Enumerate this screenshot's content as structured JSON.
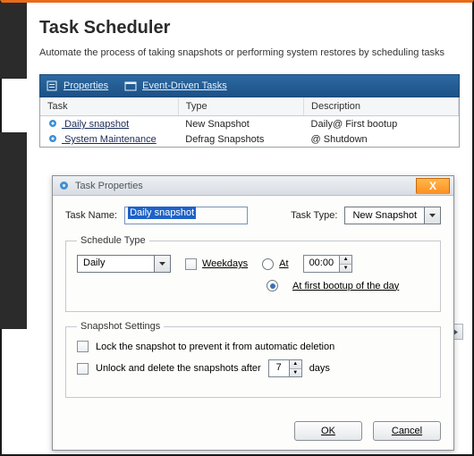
{
  "page": {
    "title": "Task Scheduler",
    "subtitle": "Automate the process of taking snapshots or performing system restores by scheduling tasks"
  },
  "tabbar": {
    "properties": "Properties",
    "event_driven": "Event-Driven Tasks"
  },
  "table": {
    "headers": {
      "task": "Task",
      "type": "Type",
      "description": "Description"
    },
    "rows": [
      {
        "task": "Daily snapshot",
        "type": "New Snapshot",
        "description": "Daily@ First bootup"
      },
      {
        "task": "System Maintenance",
        "type": "Defrag Snapshots",
        "description": "@ Shutdown"
      }
    ]
  },
  "dialog": {
    "title": "Task Properties",
    "task_name_label": "Task Name:",
    "task_name_value": "Daily snapshot",
    "task_type_label": "Task Type:",
    "task_type_value": "New Snapshot",
    "schedule_legend": "Schedule Type",
    "schedule_value": "Daily",
    "weekdays_label": "Weekdays",
    "at_label": "At",
    "at_time": "00:00",
    "first_boot_label": "At first bootup of the day",
    "snapshot_legend": "Snapshot Settings",
    "lock_label": "Lock the snapshot to prevent it from automatic deletion",
    "unlock_label_pre": "Unlock and delete the snapshots after",
    "unlock_days": "7",
    "unlock_label_post": "days",
    "ok": "OK",
    "cancel": "Cancel"
  }
}
